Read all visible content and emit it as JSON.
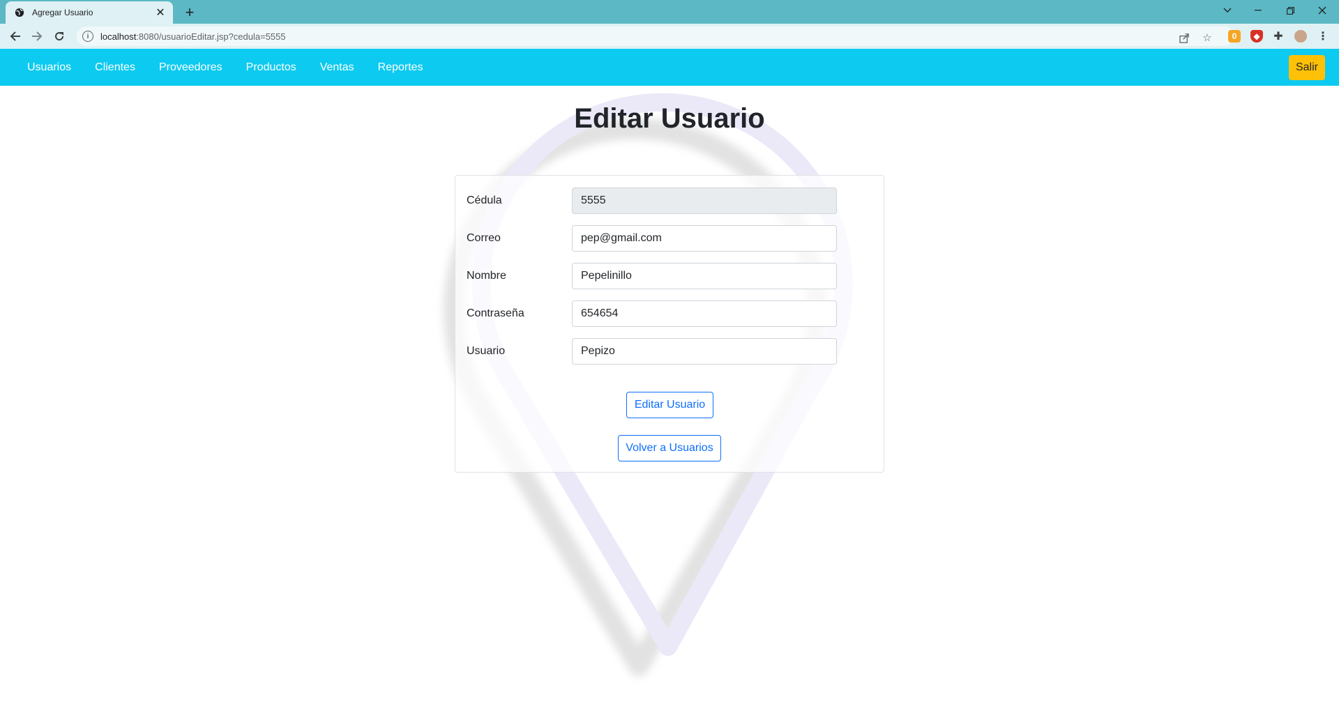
{
  "browser": {
    "tab_title": "Agregar Usuario",
    "url_host": "localhost",
    "url_rest": ":8080/usuarioEditar.jsp?cedula=5555",
    "extension_badge": "0"
  },
  "navbar": {
    "links": [
      "Usuarios",
      "Clientes",
      "Proveedores",
      "Productos",
      "Ventas",
      "Reportes"
    ],
    "logout_label": "Salir"
  },
  "page": {
    "title": "Editar Usuario"
  },
  "form": {
    "fields": [
      {
        "label": "Cédula",
        "value": "5555",
        "disabled": true
      },
      {
        "label": "Correo",
        "value": "pep@gmail.com"
      },
      {
        "label": "Nombre",
        "value": "Pepelinillo"
      },
      {
        "label": "Contraseña",
        "value": "654654"
      },
      {
        "label": "Usuario",
        "value": "Pepizo"
      }
    ],
    "submit_label": "Editar Usuario",
    "back_label": "Volver a Usuarios"
  },
  "colors": {
    "navbar": "#0dcaf0",
    "logout": "#ffc107",
    "primary": "#0d6efd",
    "browser_frame": "#5bb8c4"
  }
}
